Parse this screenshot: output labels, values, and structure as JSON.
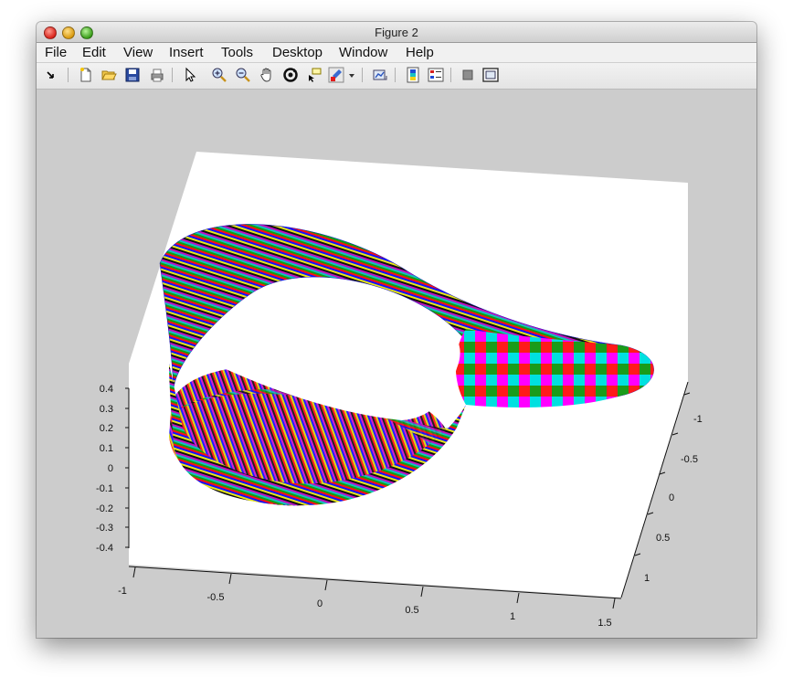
{
  "window": {
    "title": "Figure 2"
  },
  "menu": [
    "File",
    "Edit",
    "View",
    "Insert",
    "Tools",
    "Desktop",
    "Window",
    "Help"
  ],
  "toolbar_icons": [
    "edit-plot-arrow-icon",
    "new-figure-icon",
    "open-folder-icon",
    "save-icon",
    "print-icon",
    "pointer-icon",
    "zoom-in-icon",
    "zoom-out-icon",
    "pan-hand-icon",
    "rotate-3d-icon",
    "data-cursor-icon",
    "brush-icon",
    "brush-dropdown-icon",
    "link-plot-icon",
    "insert-colorbar-icon",
    "insert-legend-icon",
    "hide-plot-tools-icon",
    "show-plot-tools-icon"
  ],
  "axes": {
    "z_ticks": [
      "0.4",
      "0.3",
      "0.2",
      "0.1",
      "0",
      "-0.1",
      "-0.2",
      "-0.3",
      "-0.4"
    ],
    "x_ticks": [
      "-1",
      "-0.5",
      "0",
      "0.5",
      "1",
      "1.5"
    ],
    "y_ticks": [
      "-1",
      "-0.5",
      "0",
      "0.5",
      "1"
    ]
  },
  "plot": {
    "type": "surface",
    "description_colors": [
      "#ff0000",
      "#00ff00",
      "#0000ff",
      "#ffff00",
      "#ff00ff",
      "#00ffff",
      "#000000"
    ]
  }
}
